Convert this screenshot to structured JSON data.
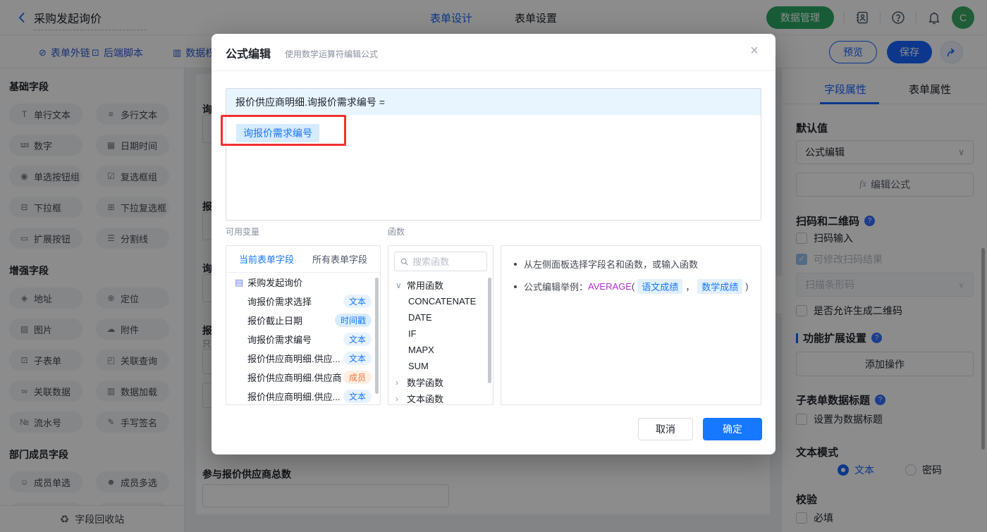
{
  "app": {
    "title": "采购发起询价",
    "nav_tabs": [
      {
        "label": "表单设计",
        "active": true
      },
      {
        "label": "表单设置",
        "active": false
      }
    ],
    "data_manage_button": "数据管理",
    "avatar_initial": "C"
  },
  "toolbar": {
    "links": [
      {
        "label": "表单外链"
      },
      {
        "label": "后端脚本"
      },
      {
        "label": "数据权"
      }
    ],
    "preview_button": "预览",
    "save_button": "保存"
  },
  "sidebar": {
    "sections": [
      {
        "title": "基础字段",
        "items": [
          {
            "label": "单行文本",
            "icon": "single-line-text"
          },
          {
            "label": "多行文本",
            "icon": "multi-line-text"
          },
          {
            "label": "数字",
            "icon": "number"
          },
          {
            "label": "日期时间",
            "icon": "datetime"
          },
          {
            "label": "单选按钮组",
            "icon": "radio-group"
          },
          {
            "label": "复选框组",
            "icon": "checkbox-group"
          },
          {
            "label": "下拉框",
            "icon": "select"
          },
          {
            "label": "下拉复选框",
            "icon": "multi-select"
          },
          {
            "label": "扩展按钮",
            "icon": "extend-button"
          },
          {
            "label": "分割线",
            "icon": "divider"
          }
        ]
      },
      {
        "title": "增强字段",
        "items": [
          {
            "label": "地址",
            "icon": "address"
          },
          {
            "label": "定位",
            "icon": "location"
          },
          {
            "label": "图片",
            "icon": "image"
          },
          {
            "label": "附件",
            "icon": "attachment"
          },
          {
            "label": "子表单",
            "icon": "subform"
          },
          {
            "label": "关联查询",
            "icon": "linked-query"
          },
          {
            "label": "关联数据",
            "icon": "linked-data"
          },
          {
            "label": "数据加载",
            "icon": "data-load"
          },
          {
            "label": "流水号",
            "icon": "serial-number"
          },
          {
            "label": "手写签名",
            "icon": "signature"
          }
        ]
      },
      {
        "title": "部门成员字段",
        "items": [
          {
            "label": "成员单选",
            "icon": "member-single"
          },
          {
            "label": "成员多选",
            "icon": "member-multi"
          }
        ]
      }
    ],
    "recycle_bin": "字段回收站"
  },
  "canvas": {
    "partial_labels": [
      "询",
      "报",
      "询",
      "报"
    ],
    "readonly_hint": "只",
    "total_field_label": "参与报价供应商总数"
  },
  "modal": {
    "title": "公式编辑",
    "subtitle": "使用数学运算符编辑公式",
    "formula_target": "报价供应商明细.询报价需求编号 =",
    "formula_chip": "询报价需求编号",
    "variables": {
      "label": "可用变量",
      "tabs": [
        {
          "label": "当前表单字段",
          "active": true
        },
        {
          "label": "所有表单字段",
          "active": false
        }
      ],
      "root": "采购发起询价",
      "fields": [
        {
          "name": "询报价需求选择",
          "tag": "文本",
          "tag_type": "text"
        },
        {
          "name": "报价截止日期",
          "tag": "时间戳",
          "tag_type": "time"
        },
        {
          "name": "询报价需求编号",
          "tag": "文本",
          "tag_type": "text"
        },
        {
          "name": "报价供应商明细.供应...",
          "tag": "文本",
          "tag_type": "text"
        },
        {
          "name": "报价供应商明细.供应商",
          "tag": "成员",
          "tag_type": "member"
        },
        {
          "name": "报价供应商明细.供应...",
          "tag": "文本",
          "tag_type": "text"
        }
      ]
    },
    "functions": {
      "label": "函数",
      "search_placeholder": "搜索函数",
      "groups": [
        {
          "name": "常用函数",
          "expanded": true,
          "items": [
            "CONCATENATE",
            "DATE",
            "IF",
            "MAPX",
            "SUM"
          ]
        },
        {
          "name": "数学函数",
          "expanded": false,
          "items": []
        },
        {
          "name": "文本函数",
          "expanded": false,
          "items": []
        }
      ]
    },
    "hints": {
      "line1": "从左侧面板选择字段名和函数，或输入函数",
      "line2_prefix": "公式编辑举例：",
      "line2_function": "AVERAGE",
      "paren_open": "(",
      "arg1": "语文成绩",
      "comma": "，",
      "arg2": "数学成绩",
      "paren_close": ")"
    },
    "cancel_button": "取消",
    "confirm_button": "确定"
  },
  "properties": {
    "tabs": [
      {
        "label": "字段属性",
        "active": true
      },
      {
        "label": "表单属性",
        "active": false
      }
    ],
    "default_value": {
      "label": "默认值",
      "select_value": "公式编辑",
      "fx": "fx",
      "edit_formula": "编辑公式"
    },
    "scan": {
      "title": "扫码和二维码",
      "scan_input": "扫码输入",
      "modifiable_result": "可修改扫码结果",
      "scan_type": "扫描条形码",
      "allow_qrcode": "是否允许生成二维码"
    },
    "extension": {
      "title": "功能扩展设置",
      "add_action": "添加操作"
    },
    "subform_data_title": {
      "title": "子表单数据标题",
      "set_as_title": "设置为数据标题"
    },
    "text_mode": {
      "title": "文本模式",
      "options": [
        {
          "label": "文本",
          "selected": true
        },
        {
          "label": "密码",
          "selected": false
        }
      ]
    },
    "validation": {
      "title": "校验",
      "required": "必填"
    }
  },
  "colors": {
    "primary_blue": "#1677ff",
    "brand_green": "#2ba864",
    "tag_member_orange": "#f77234",
    "annotation_red": "#f23030",
    "function_purple": "#b02fd4"
  }
}
